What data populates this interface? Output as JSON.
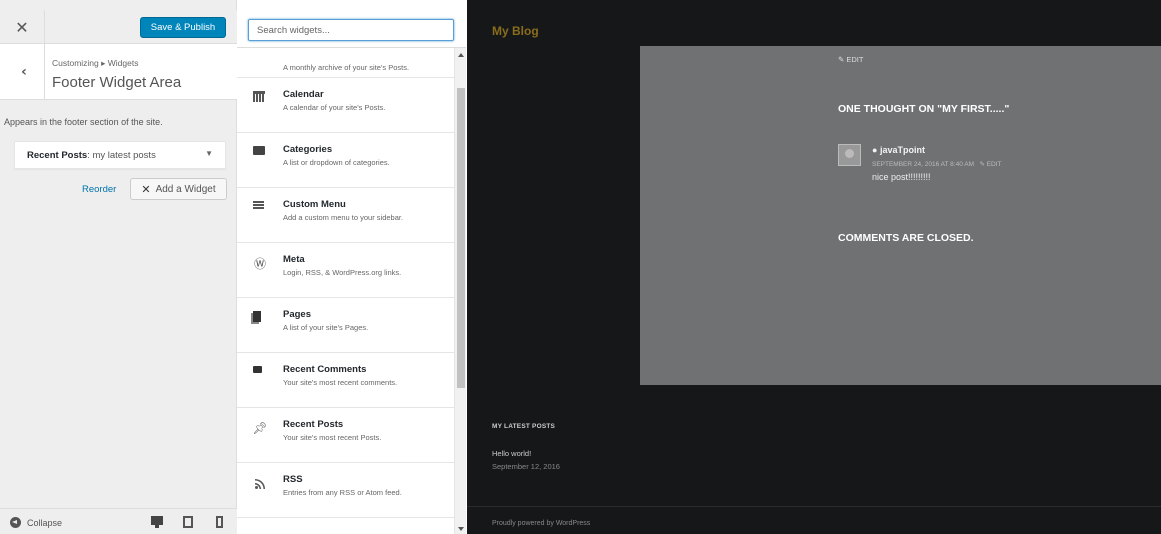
{
  "customizer": {
    "close_icon": "close-icon",
    "save_label": "Save & Publish",
    "breadcrumb": "Customizing ▸ Widgets",
    "section_title": "Footer Widget Area",
    "description": "Appears in the footer section of the site.",
    "widget": {
      "name": "Recent Posts",
      "suffix": ": my latest posts"
    },
    "reorder_label": "Reorder",
    "add_widget_label": "Add a Widget",
    "collapse_label": "Collapse",
    "accent_color": "#0085ba"
  },
  "widgets_panel": {
    "search_placeholder": "Search widgets...",
    "first_desc": "A monthly archive of your site's Posts.",
    "items": [
      {
        "name": "Calendar",
        "desc": "A calendar of your site's Posts.",
        "icon": "calendar-icon"
      },
      {
        "name": "Categories",
        "desc": "A list or dropdown of categories.",
        "icon": "folder-icon"
      },
      {
        "name": "Custom Menu",
        "desc": "Add a custom menu to your sidebar.",
        "icon": "menu-icon"
      },
      {
        "name": "Meta",
        "desc": "Login, RSS, & WordPress.org links.",
        "icon": "wordpress-icon"
      },
      {
        "name": "Pages",
        "desc": "A list of your site's Pages.",
        "icon": "pages-icon"
      },
      {
        "name": "Recent Comments",
        "desc": "Your site's most recent comments.",
        "icon": "comment-icon"
      },
      {
        "name": "Recent Posts",
        "desc": "Your site's most recent Posts.",
        "icon": "pin-icon"
      },
      {
        "name": "RSS",
        "desc": "Entries from any RSS or Atom feed.",
        "icon": "rss-icon"
      }
    ]
  },
  "preview": {
    "blog_title": "My Blog",
    "edit_label": "EDIT",
    "thought_title": "ONE THOUGHT ON \"MY FIRST.....\"",
    "comment": {
      "author": "javaTpoint",
      "meta": "SEPTEMBER 24, 2016 AT 8:40 AM",
      "edit_label": "EDIT",
      "text": "nice post!!!!!!!!!"
    },
    "closed_title": "COMMENTS ARE CLOSED.",
    "footer": {
      "heading": "MY LATEST POSTS",
      "post_title": "Hello world!",
      "post_date": "September 12, 2016"
    },
    "powered_by": "Proudly powered by WordPress"
  }
}
